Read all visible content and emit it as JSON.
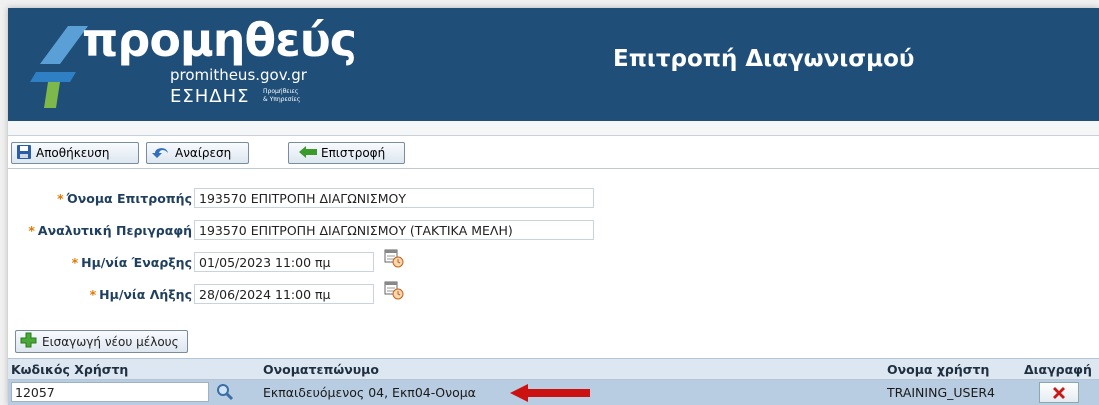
{
  "header": {
    "logo_word": "προμηθεύς",
    "logo_url": "promitheus.gov.gr",
    "logo_org": "ΕΣΗΔΗΣ",
    "logo_org_sub1": "Προμήθειες",
    "logo_org_sub2": "& Υπηρεσίες",
    "title": "Επιτροπή Διαγωνισμού"
  },
  "toolbar": {
    "save_label": "Αποθήκευση",
    "undo_label": "Αναίρεση",
    "back_label": "Επιστροφή"
  },
  "form": {
    "required_mark": "*",
    "committee_name_label": "Όνομα Επιτροπής",
    "committee_name_value": "193570 ΕΠΙΤΡΟΠΗ ΔΙΑΓΩΝΙΣΜΟΥ",
    "description_label": "Αναλυτική Περιγραφή",
    "description_value": "193570 ΕΠΙΤΡΟΠΗ ΔΙΑΓΩΝΙΣΜΟΥ (ΤΑΚΤΙΚΑ ΜΕΛΗ)",
    "start_label": "Ημ/νία Έναρξης",
    "start_value": "01/05/2023 11:00 πμ",
    "end_label": "Ημ/νία Λήξης",
    "end_value": "28/06/2024 11:00 πμ"
  },
  "members": {
    "add_label": "Εισαγωγή νέου μέλους",
    "columns": {
      "code": "Κωδικός Χρήστη",
      "fullname": "Ονοματεπώνυμο",
      "username": "Ονομα χρήστη",
      "delete": "Διαγραφή"
    },
    "rows": [
      {
        "code": "12057",
        "fullname": "Εκπαιδευόμενος 04, Εκπ04-Ονομα",
        "username": "TRAINING_USER4"
      }
    ]
  },
  "colors": {
    "header_bg": "#1f4e79",
    "selected_row": "#b9cde2",
    "arrow": "#cc1111"
  }
}
